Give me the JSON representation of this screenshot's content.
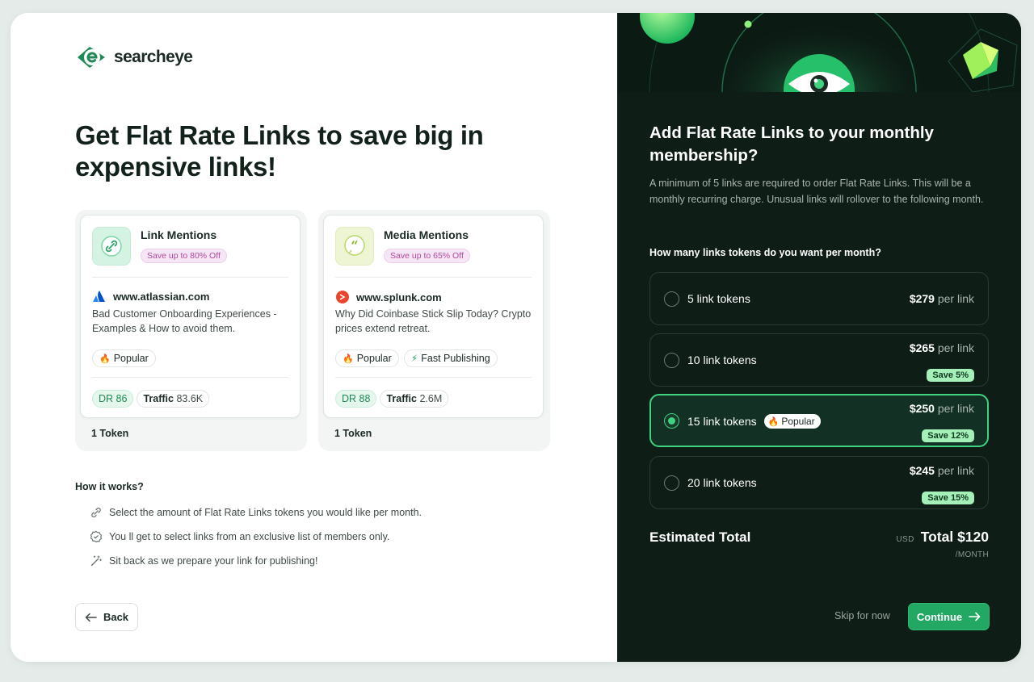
{
  "brand": {
    "name": "searcheye"
  },
  "left": {
    "headline": "Get Flat Rate Links to save big in expensive links!",
    "cards": [
      {
        "title": "Link Mentions",
        "save": "Save up to 80% Off",
        "site": "www.atlassian.com",
        "description": "Bad Customer Onboarding Experiences - Examples & How to avoid them.",
        "tags": [
          "Popular"
        ],
        "dr_label": "DR 86",
        "traffic_label": "Traffic",
        "traffic_value": "83.6K",
        "token": "1 Token"
      },
      {
        "title": "Media Mentions",
        "save": "Save up to 65% Off",
        "site": "www.splunk.com",
        "description": "Why Did Coinbase Stick Slip Today? Crypto prices extend retreat.",
        "tags": [
          "Popular",
          "Fast Publishing"
        ],
        "dr_label": "DR 88",
        "traffic_label": "Traffic",
        "traffic_value": "2.6M",
        "token": "1 Token"
      }
    ],
    "how_it_works": {
      "title": "How it works?",
      "steps": [
        "Select the amount of Flat Rate Links tokens you would like per month.",
        "You ll get to select links from an exclusive list of members only.",
        "Sit back as we prepare your link for publishing!"
      ]
    },
    "back_label": "Back"
  },
  "right": {
    "title": "Add Flat Rate Links to your monthly membership?",
    "description": "A minimum of 5 links are required to order Flat Rate Links. This will be a monthly recurring charge. Unusual links will rollover to the following month.",
    "question": "How many links tokens do you want per month?",
    "options": [
      {
        "label": "5 link tokens",
        "price": "$279",
        "unit": "per link",
        "save": "",
        "popular": "",
        "selected": false
      },
      {
        "label": "10 link tokens",
        "price": "$265",
        "unit": "per link",
        "save": "Save 5%",
        "popular": "",
        "selected": false
      },
      {
        "label": "15 link tokens",
        "price": "$250",
        "unit": "per link",
        "save": "Save 12%",
        "popular": "Popular",
        "selected": true
      },
      {
        "label": "20 link tokens",
        "price": "$245",
        "unit": "per link",
        "save": "Save 15%",
        "popular": "",
        "selected": false
      }
    ],
    "estimated_label": "Estimated Total",
    "currency": "USD",
    "total": "Total $120",
    "per_month": "/MONTH",
    "skip_label": "Skip for now",
    "continue_label": "Continue"
  },
  "colors": {
    "accent": "#22a862",
    "dark_bg": "#0f1d17",
    "highlight": "#3fd27f",
    "save_badge": "#a5f0b9"
  }
}
